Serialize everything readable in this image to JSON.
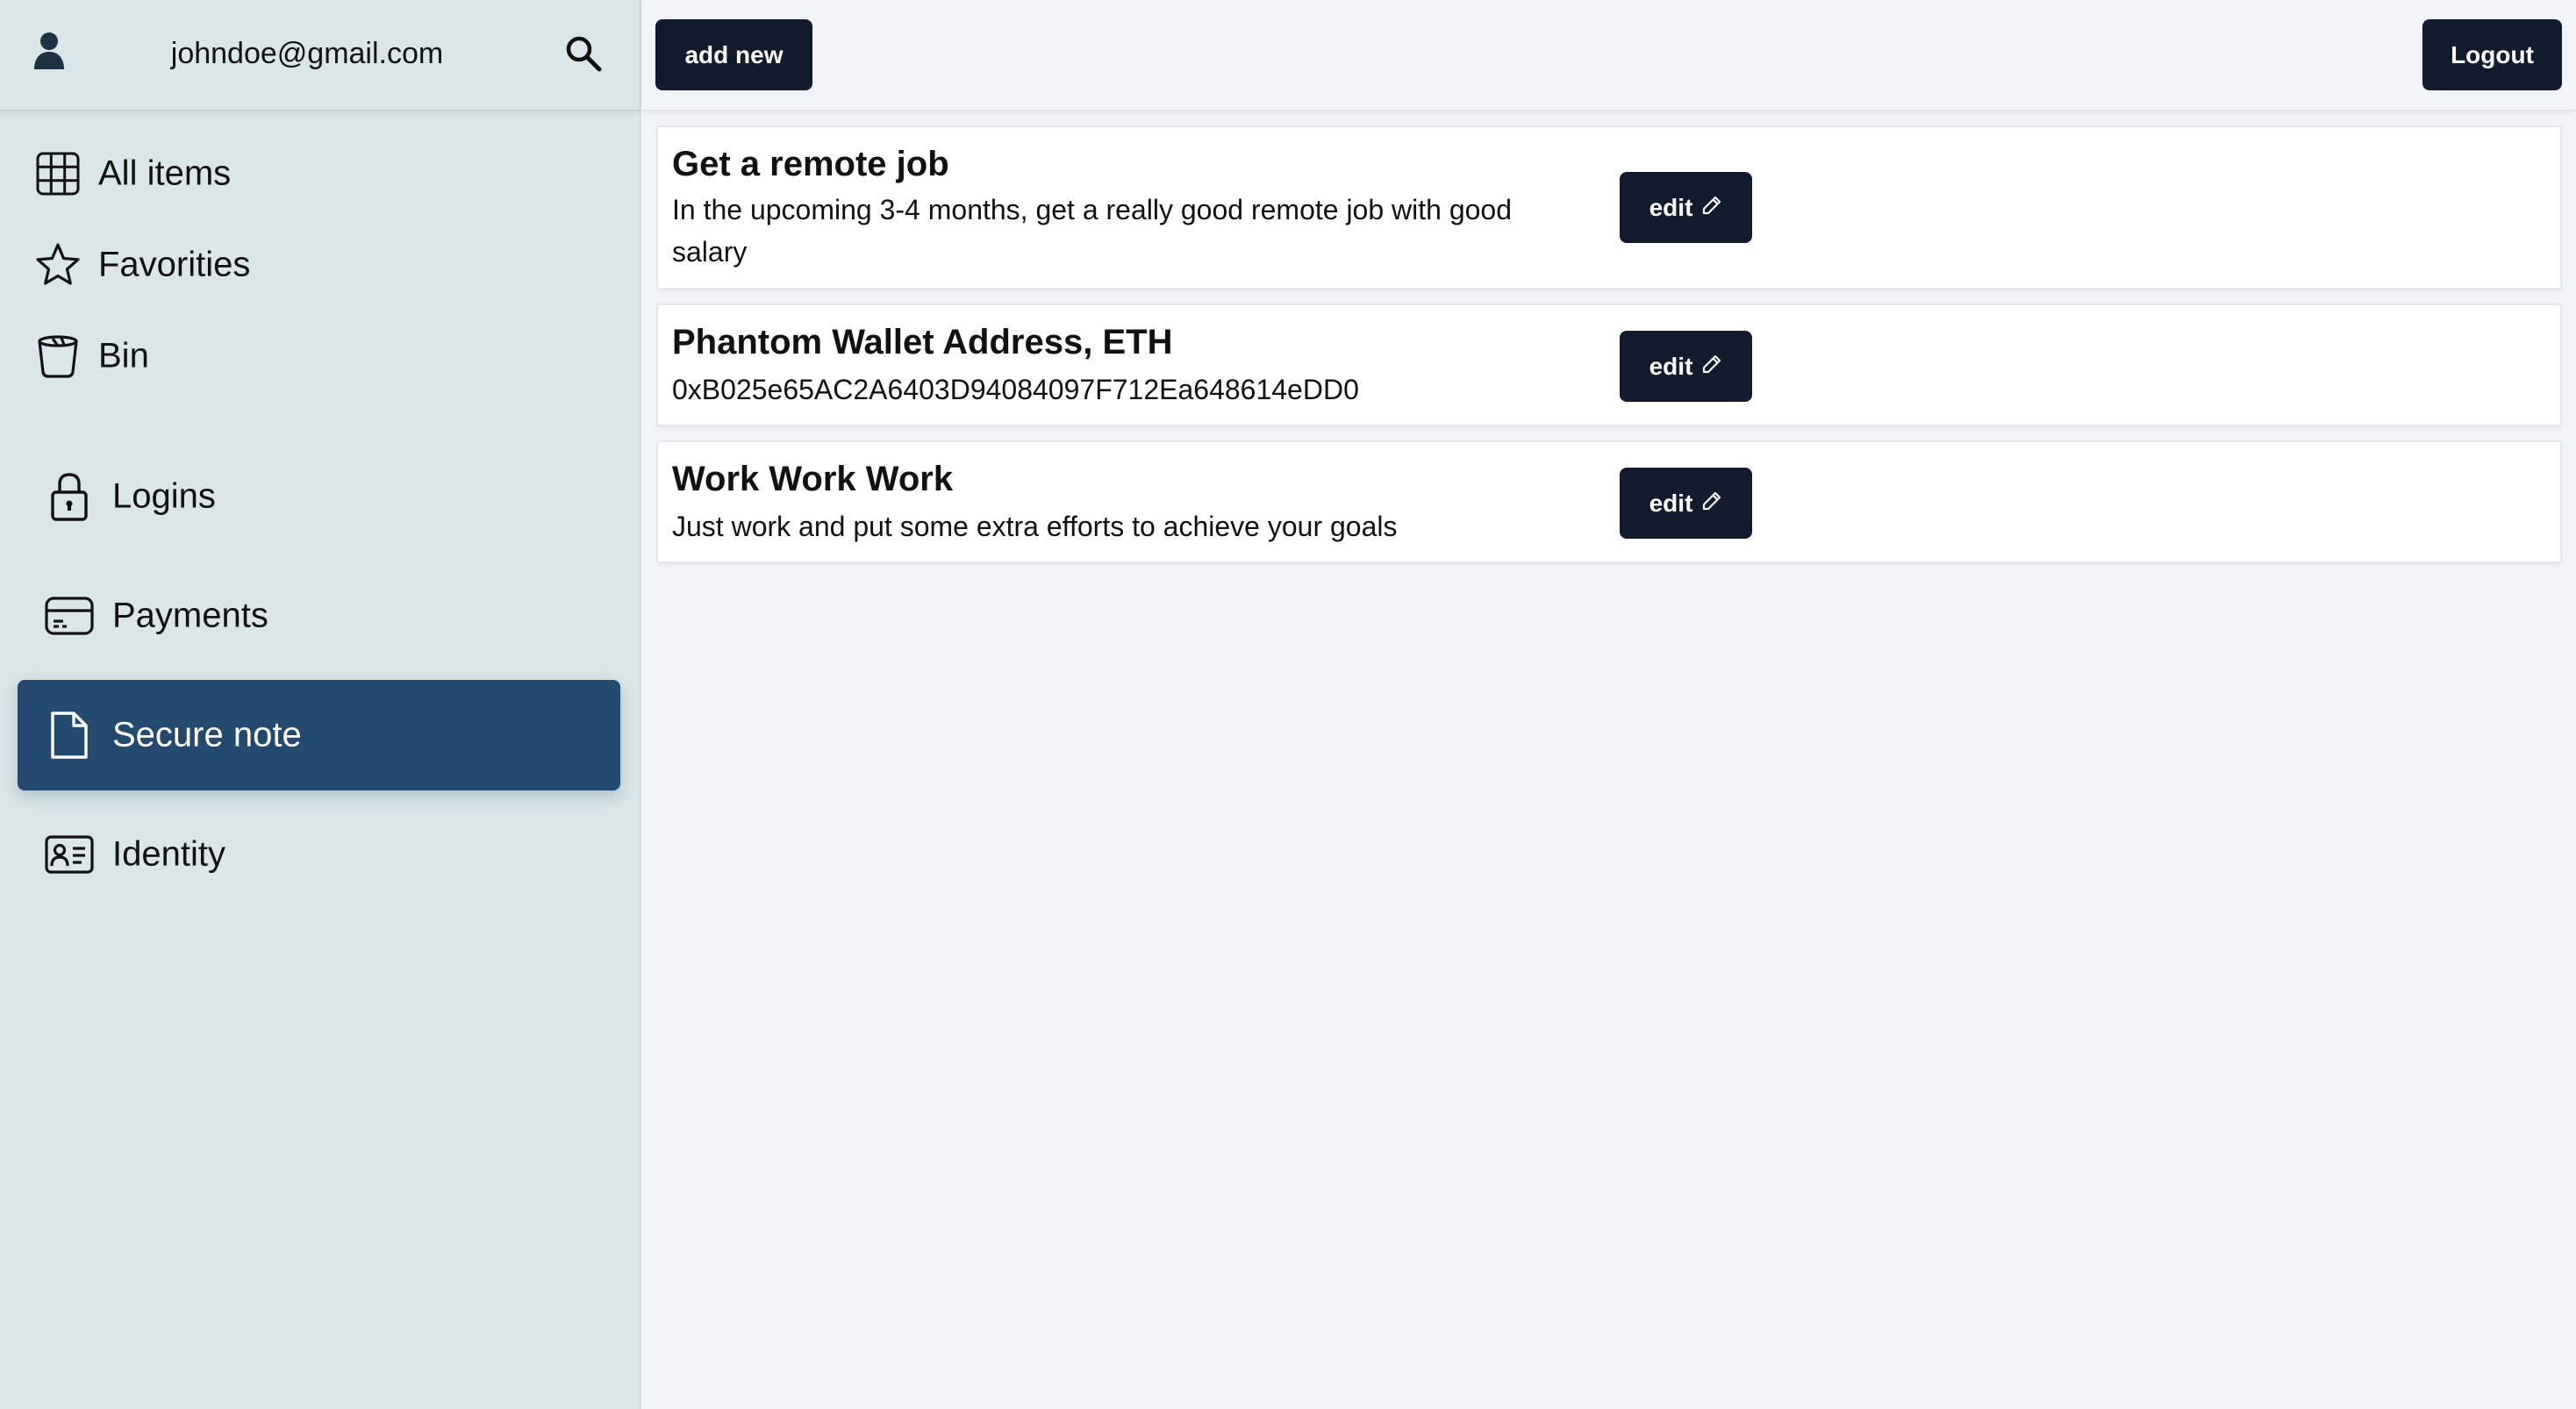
{
  "sidebar": {
    "user_email": "johndoe@gmail.com",
    "nav_top": [
      {
        "label": "All items",
        "icon": "grid-icon"
      },
      {
        "label": "Favorities",
        "icon": "star-icon"
      },
      {
        "label": "Bin",
        "icon": "bin-icon"
      }
    ],
    "categories": [
      {
        "label": "Logins",
        "icon": "lock-icon"
      },
      {
        "label": "Payments",
        "icon": "card-icon"
      },
      {
        "label": "Secure note",
        "icon": "document-icon",
        "active": true
      },
      {
        "label": "Identity",
        "icon": "id-card-icon"
      }
    ]
  },
  "topbar": {
    "add_label": "add new",
    "logout_label": "Logout"
  },
  "notes": [
    {
      "title": "Get a remote job",
      "body": "In the upcoming 3-4 months, get a really good remote job with good salary",
      "edit_label": "edit"
    },
    {
      "title": "Phantom Wallet Address, ETH",
      "body": "0xB025e65AC2A6403D94084097F712Ea648614eDD0",
      "edit_label": "edit"
    },
    {
      "title": "Work Work Work",
      "body": "Just work and put some extra efforts to achieve your goals",
      "edit_label": "edit"
    }
  ],
  "colors": {
    "sidebar_bg": "#dae6e8",
    "main_bg": "#f0f4f9",
    "active_nav": "#234a6e",
    "button_dark": "#121a2e"
  }
}
